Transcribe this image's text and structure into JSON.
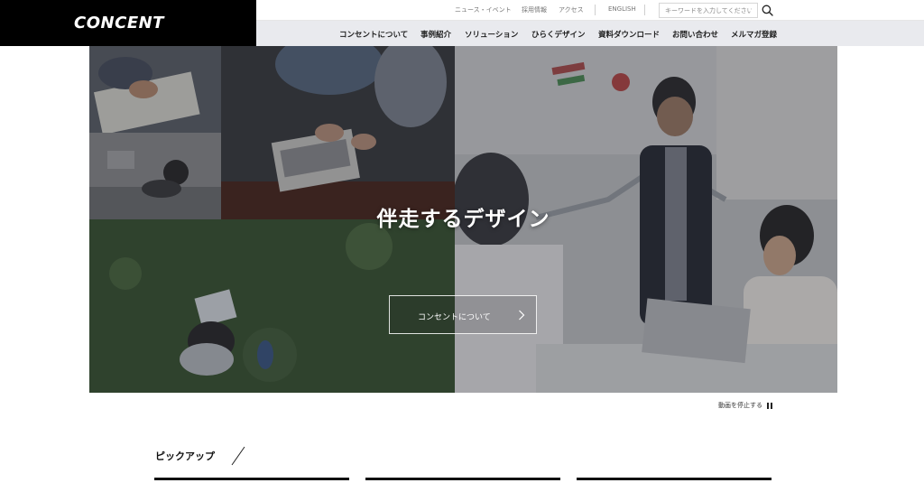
{
  "header": {
    "logo": "CONCENT",
    "utility_links": [
      "ニュース・イベント",
      "採用情報",
      "アクセス",
      "ENGLISH"
    ],
    "search": {
      "placeholder": "キーワードを入力してください",
      "icon": "search-icon"
    },
    "nav": [
      "コンセントについて",
      "事例紹介",
      "ソリューション",
      "ひらくデザイン",
      "資料ダウンロード",
      "お問い合わせ",
      "メルマガ登録"
    ]
  },
  "hero": {
    "title": "伴走するデザイン",
    "button_label": "コンセントについて",
    "button_icon": "chevron-right-icon",
    "pause_label": "動画を停止する",
    "pause_icon": "pause-icon"
  },
  "pickup": {
    "title": "ピックアップ"
  }
}
